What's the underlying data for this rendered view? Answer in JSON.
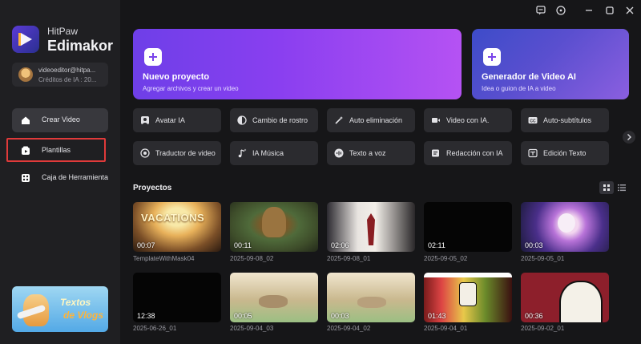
{
  "brand": {
    "top": "HitPaw",
    "name": "Edimakor"
  },
  "account": {
    "email": "videoeditor@hitpa...",
    "credits": "Créditos de IA : 20..."
  },
  "sidebar": {
    "items": [
      {
        "label": "Crear Video"
      },
      {
        "label": "Plantillas"
      },
      {
        "label": "Caja de Herramienta"
      }
    ]
  },
  "promo": {
    "line1": "Textos",
    "line2": "de Vlogs"
  },
  "hero": {
    "new_project": {
      "title": "Nuevo proyecto",
      "subtitle": "Agregar archivos y crear un video"
    },
    "ai_generator": {
      "title": "Generador de Video AI",
      "subtitle": "Idea o guion de IA a video"
    }
  },
  "tools": [
    {
      "label": "Avatar IA",
      "icon": "avatar-icon"
    },
    {
      "label": "Cambio de rostro",
      "icon": "face-swap-icon"
    },
    {
      "label": "Auto eliminación",
      "icon": "magic-wand-icon"
    },
    {
      "label": "Video con IA.",
      "icon": "video-ai-icon"
    },
    {
      "label": "Auto-subtítulos",
      "icon": "cc-icon"
    },
    {
      "label": "Traductor de video",
      "icon": "translate-icon"
    },
    {
      "label": "IA Música",
      "icon": "music-icon"
    },
    {
      "label": "Texto a voz",
      "icon": "voice-icon"
    },
    {
      "label": "Redacción con IA",
      "icon": "write-icon"
    },
    {
      "label": "Edición Texto",
      "icon": "text-edit-icon"
    }
  ],
  "projects_title": "Proyectos",
  "projects": [
    {
      "duration": "00:07",
      "name": "TemplateWithMask04"
    },
    {
      "duration": "00:11",
      "name": "2025-09-08_02"
    },
    {
      "duration": "02:06",
      "name": "2025-09-08_01"
    },
    {
      "duration": "02:11",
      "name": "2025-09-05_02"
    },
    {
      "duration": "00:03",
      "name": "2025-09-05_01"
    },
    {
      "duration": "12:38",
      "name": "2025-06-26_01"
    },
    {
      "duration": "00:05",
      "name": "2025-09-04_03"
    },
    {
      "duration": "00:03",
      "name": "2025-09-04_02"
    },
    {
      "duration": "01:43",
      "name": "2025-09-04_01"
    },
    {
      "duration": "00:36",
      "name": "2025-09-02_01"
    }
  ],
  "thumb_texts": {
    "vacations": "VACATIONS"
  },
  "colors": {
    "accent": "#7a44ea",
    "highlight_border": "#e03a3a",
    "sidebar": "#1f1f22",
    "background": "#161618"
  }
}
